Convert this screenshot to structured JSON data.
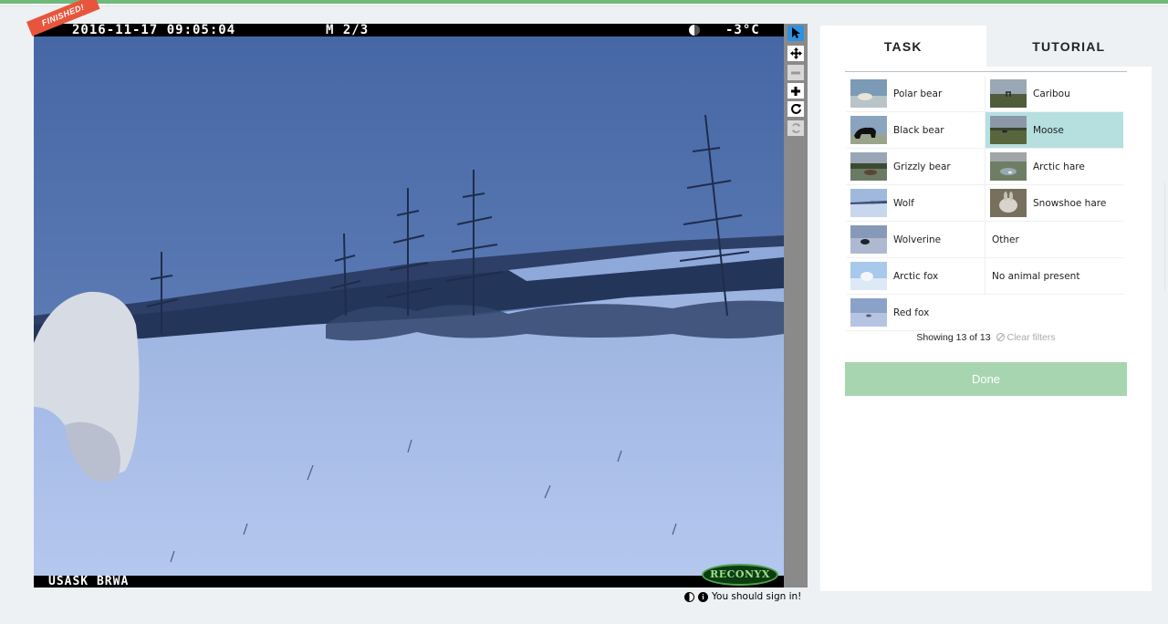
{
  "viewer": {
    "datetime": "2016-11-17 09:05:04",
    "frame": "M 2/3",
    "temperature": "-3°C",
    "site": "USASK BRWA",
    "camera_brand": "RECONYX",
    "status_ribbon": "FINISHED!",
    "sign_in_message": "You should sign in!"
  },
  "toolbar": {
    "tools": [
      "pointer-icon",
      "move-icon",
      "zoom-out-icon",
      "zoom-in-icon",
      "rotate-icon",
      "reset-icon"
    ]
  },
  "tabs": {
    "task": "TASK",
    "tutorial": "TUTORIAL"
  },
  "choices": {
    "left": [
      {
        "label": "Polar bear"
      },
      {
        "label": "Black bear"
      },
      {
        "label": "Grizzly bear"
      },
      {
        "label": "Wolf"
      },
      {
        "label": "Wolverine"
      },
      {
        "label": "Arctic fox"
      },
      {
        "label": "Red fox"
      }
    ],
    "right": [
      {
        "label": "Caribou"
      },
      {
        "label": "Moose"
      },
      {
        "label": "Arctic hare"
      },
      {
        "label": "Snowshoe hare"
      },
      {
        "label": "Other"
      },
      {
        "label": "No animal present"
      }
    ],
    "selected": "Moose"
  },
  "filter": {
    "showing": "Showing 13 of 13",
    "clear": "Clear filters"
  },
  "done_label": "Done",
  "colors": {
    "accent_green": "#6fba7b",
    "done_button": "#a7d5b0",
    "selected_choice": "#b6dfe0",
    "ribbon": "#e8553d",
    "active_tool": "#2e91e1"
  }
}
